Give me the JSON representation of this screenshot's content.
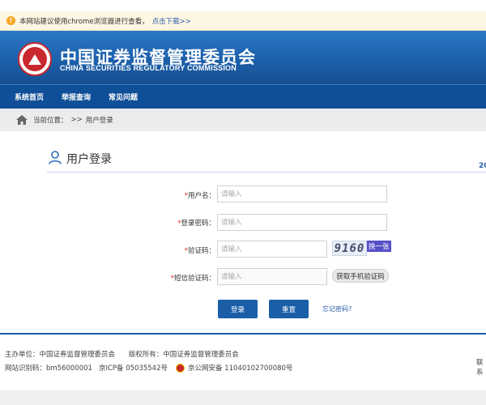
{
  "notice": {
    "text": "本网站建议使用chrome浏览器进行查看，",
    "link": "点击下载>>"
  },
  "header": {
    "title_cn": "中国证券监督管理委员会",
    "title_en": "CHINA SECURITIES REGULATORY COMMISSION"
  },
  "nav": {
    "items": [
      "系统首页",
      "举报查询",
      "常见问题"
    ]
  },
  "breadcrumb": {
    "label": "当前位置：",
    "sep": ">>",
    "current": "用户登录"
  },
  "panel": {
    "title": "用户登录",
    "edge_text": "20"
  },
  "form": {
    "username": {
      "label": "用户名：",
      "placeholder": "请输入",
      "value": ""
    },
    "password": {
      "label": "登录密码：",
      "placeholder": "请输入",
      "value": ""
    },
    "captcha": {
      "label": "验证码：",
      "placeholder": "请输入",
      "value": "",
      "image_text": "9160",
      "refresh": "换一张"
    },
    "sms": {
      "label": "短信验证码：",
      "placeholder": "请输入",
      "value": "",
      "button": "获取手机验证码"
    },
    "required_mark": "*"
  },
  "actions": {
    "login": "登录",
    "reset": "重置",
    "forgot": "忘记密码?"
  },
  "footer": {
    "host_label": "主办单位：",
    "host": "中国证券监督管理委员会",
    "copyright_label": "版权所有：",
    "copyright": "中国证券监督管理委员会",
    "site_code": "网站识别码：bm56000001",
    "icp": "京ICP备 05035542号",
    "police": "京公网安备 11040102700080号",
    "contact": "联系"
  },
  "colors": {
    "brand_blue": "#1b5ea8",
    "nav_blue": "#0f4f97",
    "required_red": "#d9262e",
    "link_blue": "#2a5caa"
  }
}
